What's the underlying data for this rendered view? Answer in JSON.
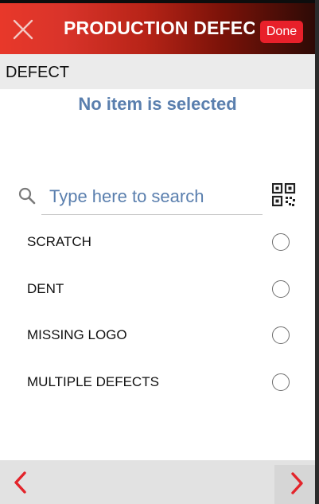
{
  "header": {
    "title": "PRODUCTION DEFEC...",
    "done_label": "Done",
    "close_icon": "close-icon",
    "accent_color": "#e8202a"
  },
  "section": {
    "label": "DEFECT"
  },
  "selection": {
    "status": "No item is selected"
  },
  "search": {
    "placeholder": "Type here to search",
    "value": "",
    "icon": "search-icon",
    "scan_icon": "qr-code-icon"
  },
  "list": {
    "items": [
      {
        "label": "SCRATCH",
        "selected": false
      },
      {
        "label": "DENT",
        "selected": false
      },
      {
        "label": "MISSING LOGO",
        "selected": false
      },
      {
        "label": "MULTIPLE DEFECTS",
        "selected": false
      }
    ]
  },
  "footer": {
    "prev_icon": "chevron-left-icon",
    "next_icon": "chevron-right-icon"
  }
}
